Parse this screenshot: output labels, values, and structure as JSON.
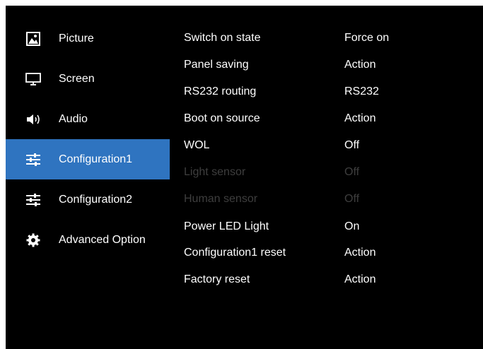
{
  "colors": {
    "background": "#000000",
    "selected": "#2f74c0",
    "text": "#ffffff",
    "disabled_text": "#3e3e3e"
  },
  "sidebar": {
    "items": [
      {
        "label": "Picture",
        "icon": "picture-icon",
        "active": false
      },
      {
        "label": "Screen",
        "icon": "monitor-icon",
        "active": false
      },
      {
        "label": "Audio",
        "icon": "speaker-icon",
        "active": false
      },
      {
        "label": "Configuration1",
        "icon": "sliders-icon",
        "active": true
      },
      {
        "label": "Configuration2",
        "icon": "sliders-icon",
        "active": false
      },
      {
        "label": "Advanced Option",
        "icon": "gear-icon",
        "active": false
      }
    ]
  },
  "settings": {
    "rows": [
      {
        "name": "Switch on state",
        "value": "Force on",
        "enabled": true
      },
      {
        "name": "Panel saving",
        "value": "Action",
        "enabled": true
      },
      {
        "name": "RS232 routing",
        "value": "RS232",
        "enabled": true
      },
      {
        "name": "Boot on source",
        "value": "Action",
        "enabled": true
      },
      {
        "name": "WOL",
        "value": "Off",
        "enabled": true
      },
      {
        "name": "Light sensor",
        "value": "Off",
        "enabled": false
      },
      {
        "name": "Human sensor",
        "value": "Off",
        "enabled": false
      },
      {
        "name": "Power LED Light",
        "value": "On",
        "enabled": true
      },
      {
        "name": "Configuration1 reset",
        "value": "Action",
        "enabled": true
      },
      {
        "name": "Factory reset",
        "value": "Action",
        "enabled": true
      }
    ]
  }
}
